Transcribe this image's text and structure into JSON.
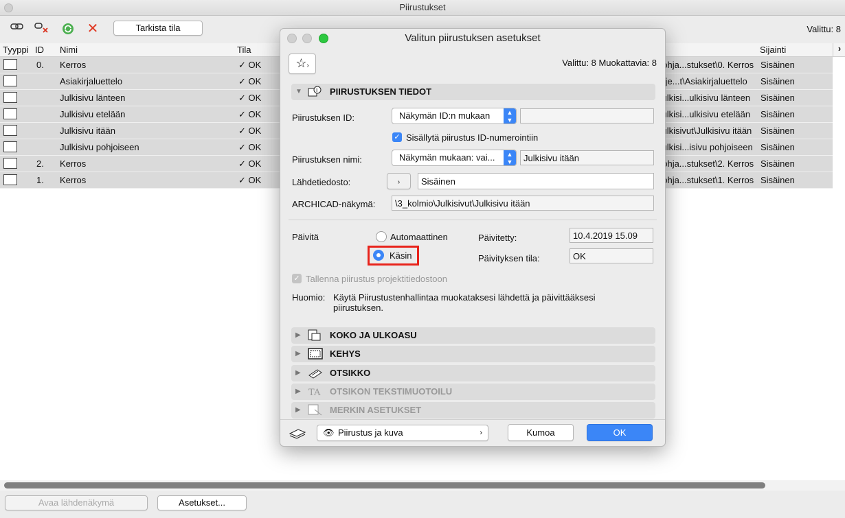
{
  "window": {
    "title": "Piirustukset",
    "selected": "Valittu: 8"
  },
  "toolbar": {
    "check_status": "Tarkista tila"
  },
  "columns": {
    "type": "Tyyppi",
    "id": "ID",
    "name": "Nimi",
    "status": "Tila",
    "location": "Sijainti"
  },
  "rows": [
    {
      "id": "0.",
      "name": "Kerros",
      "status": "✓ OK",
      "path": "pohja...stukset\\0. Kerros",
      "location": "Sisäinen"
    },
    {
      "id": "",
      "name": "Asiakirjaluettelo",
      "status": "✓ OK",
      "path": "roje...t\\Asiakirjaluettelo",
      "location": "Sisäinen"
    },
    {
      "id": "",
      "name": "Julkisivu länteen",
      "status": "✓ OK",
      "path": "Julkisi...ulkisivu länteen",
      "location": "Sisäinen"
    },
    {
      "id": "",
      "name": "Julkisivu etelään",
      "status": "✓ OK",
      "path": "Julkisi...ulkisivu etelään",
      "location": "Sisäinen"
    },
    {
      "id": "",
      "name": "Julkisivu itään",
      "status": "✓ OK",
      "path": "Julkisivut\\Julkisivu itään",
      "location": "Sisäinen"
    },
    {
      "id": "",
      "name": "Julkisivu pohjoiseen",
      "status": "✓ OK",
      "path": "Julkisi...isivu pohjoiseen",
      "location": "Sisäinen"
    },
    {
      "id": "2.",
      "name": "Kerros",
      "status": "✓ OK",
      "path": "pohja...stukset\\2. Kerros",
      "location": "Sisäinen"
    },
    {
      "id": "1.",
      "name": "Kerros",
      "status": "✓ OK",
      "path": "pohja...stukset\\1. Kerros",
      "location": "Sisäinen"
    }
  ],
  "bottom": {
    "open_source": "Avaa lähdenäkymä",
    "settings": "Asetukset..."
  },
  "dialog": {
    "title": "Valitun piirustuksen asetukset",
    "counts": "Valittu: 8 Muokattavia: 8",
    "section_info": "PIIRUSTUKSEN TIEDOT",
    "id_label": "Piirustuksen ID:",
    "id_popup": "Näkymän ID:n mukaan",
    "id_value": "",
    "include_numbering": "Sisällytä piirustus ID-numerointiin",
    "name_label": "Piirustuksen nimi:",
    "name_popup": "Näkymän mukaan: vai...",
    "name_value": "Julkisivu itään",
    "source_label": "Lähdetiedosto:",
    "source_value": "Sisäinen",
    "view_label": "ARCHICAD-näkymä:",
    "view_value": "\\3_kolmio\\Julkisivut\\Julkisivu itään",
    "update_label": "Päivitä",
    "auto_option": "Automaattinen",
    "manual_option": "Käsin",
    "updated_label": "Päivitetty:",
    "updated_value": "10.4.2019 15.09",
    "update_status_label": "Päivityksen tila:",
    "update_status_value": "OK",
    "save_in_project": "Tallenna piirustus projektitiedostoon",
    "note_label": "Huomio:",
    "note_text": "Käytä Piirustustenhallintaa muokataksesi lähdettä ja päivittääksesi piirustuksen.",
    "section_size": "KOKO JA ULKOASU",
    "section_frame": "KEHYS",
    "section_title": "OTSIKKO",
    "section_title_text": "OTSIKON TEKSTIMUOTOILU",
    "section_marker": "MERKIN ASETUKSET",
    "view_mode": "Piirustus ja kuva",
    "cancel": "Kumoa",
    "ok": "OK"
  },
  "colors": {
    "accent": "#3b86f7",
    "highlight": "#e8231b",
    "row_bg": "#dadada"
  }
}
